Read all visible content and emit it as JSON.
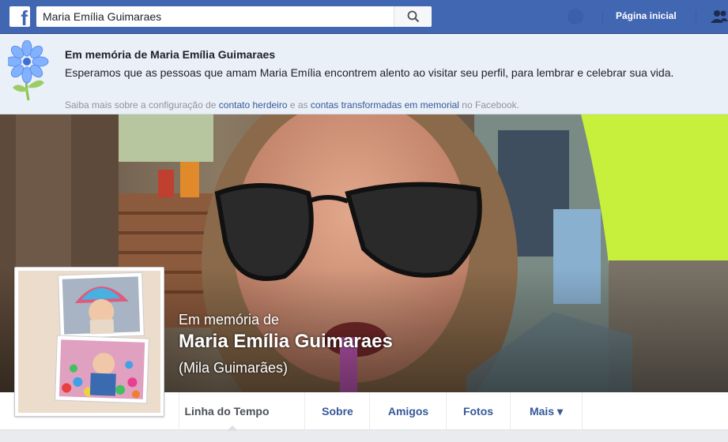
{
  "topbar": {
    "search_value": "Maria Emília Guimaraes",
    "home_label": "Página inicial",
    "logo_letter": "f"
  },
  "memorial": {
    "title": "Em memória de Maria Emília Guimaraes",
    "text": "Esperamos que as pessoas que amam Maria Emília encontrem alento ao visitar seu perfil, para lembrar e celebrar sua vida.",
    "note_prefix": "Saiba mais sobre a configuração de ",
    "link1": "contato herdeiro",
    "note_middle": " e as ",
    "link2": "contas transformadas em memorial",
    "note_suffix": " no Facebook."
  },
  "profile": {
    "memorial_prefix": "Em memória de",
    "name": "Maria Emília Guimaraes",
    "alternate_name": "(Mila Guimarães)"
  },
  "tabs": [
    {
      "label": "Linha do Tempo",
      "active": true
    },
    {
      "label": "Sobre"
    },
    {
      "label": "Amigos"
    },
    {
      "label": "Fotos"
    },
    {
      "label": "Mais ▾"
    }
  ],
  "colors": {
    "brand": "#4267b2",
    "link": "#365899",
    "banner_bg": "#eaf0f8"
  }
}
